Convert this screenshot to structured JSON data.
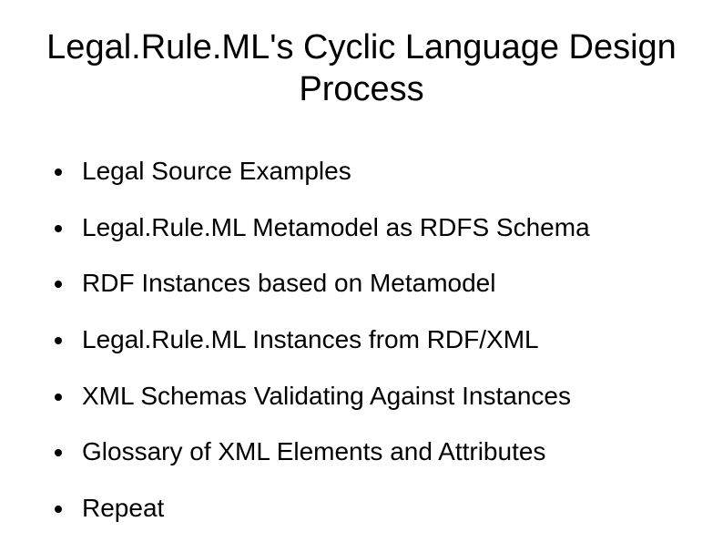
{
  "title": "Legal.Rule.ML's Cyclic Language Design Process",
  "bullets": [
    "Legal Source Examples",
    "Legal.Rule.ML Metamodel as RDFS Schema",
    "RDF Instances based on Metamodel",
    "Legal.Rule.ML Instances from RDF/XML",
    "XML Schemas Validating Against Instances",
    "Glossary of XML Elements and Attributes",
    "Repeat"
  ]
}
